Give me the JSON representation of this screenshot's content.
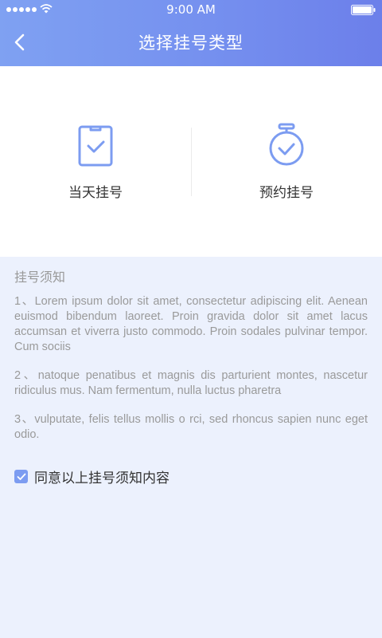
{
  "status_bar": {
    "time": "9:00 AM"
  },
  "header": {
    "title": "选择挂号类型"
  },
  "options": [
    {
      "label": "当天挂号",
      "icon": "clipboard-check-icon"
    },
    {
      "label": "预约挂号",
      "icon": "stopwatch-check-icon"
    }
  ],
  "notice": {
    "title": "挂号须知",
    "paragraphs": [
      "1、Lorem ipsum dolor sit amet, consectetur adipiscing elit. Aenean euismod bibendum laoreet. Proin gravida dolor sit amet lacus accumsan et viverra justo commodo. Proin sodales pulvinar tempor. Cum sociis",
      "2、natoque penatibus et magnis dis parturient montes, nascetur ridiculus mus. Nam fermentum, nulla luctus pharetra",
      "3、vulputate, felis tellus mollis o rci, sed rhoncus sapien nunc eget odio."
    ]
  },
  "agree": {
    "label": "同意以上挂号须知内容",
    "checked": true
  },
  "colors": {
    "accent": "#7c9cf1",
    "header_start": "#7fa1f2",
    "header_end": "#6c7fea",
    "background": "#ecf1fd"
  }
}
